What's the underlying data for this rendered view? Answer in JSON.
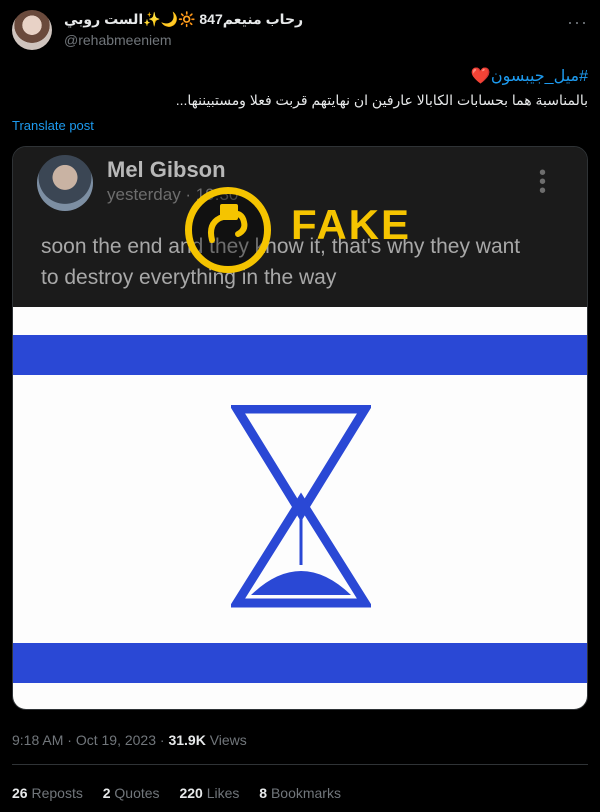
{
  "tweet": {
    "display_name": "رحاب منيعم847 🔆🌙✨الست روبي",
    "handle": "@rehabmeeniem",
    "more_icon": "ellipsis-icon",
    "hashtag": "#ميل_جيبسون",
    "body": "بالمناسبة هما بحسابات الكابالا عارفين ان نهايتهم قربت فعلا ومستبيننها...",
    "translate_label": "Translate post",
    "time": "9:18 AM",
    "date": "Oct 19, 2023",
    "views_count": "31.9K",
    "views_label": "Views"
  },
  "media": {
    "fb_name": "Mel Gibson",
    "fb_date": "yesterday · 19:30",
    "fb_text": "soon the end and they know it, that's why they want to destroy everything in the way",
    "stamp_label": "FAKE",
    "accent_colors": {
      "stamp": "#f5c400",
      "flag_blue": "#2a48d5",
      "link": "#1d9bf0"
    }
  },
  "stats": {
    "reposts_count": "26",
    "reposts_label": "Reposts",
    "quotes_count": "2",
    "quotes_label": "Quotes",
    "likes_count": "220",
    "likes_label": "Likes",
    "bookmarks_count": "8",
    "bookmarks_label": "Bookmarks"
  }
}
